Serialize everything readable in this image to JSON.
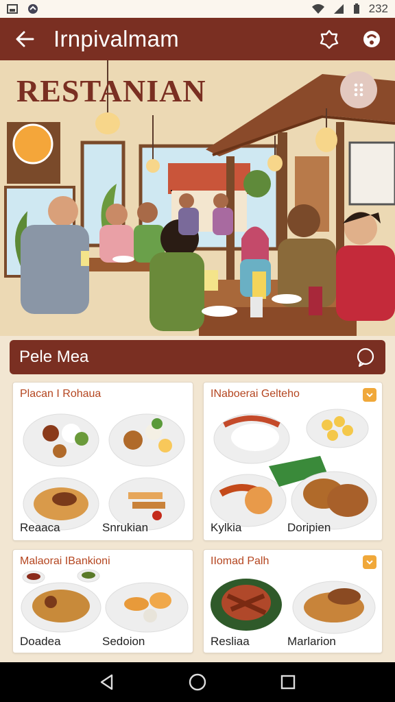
{
  "status_bar": {
    "time": "232"
  },
  "app_bar": {
    "title": "Irnpivalmam"
  },
  "hero": {
    "title": "RESTANIAN"
  },
  "section": {
    "label": "Pele Mea"
  },
  "cards": [
    {
      "title": "Placan I Rohaua",
      "dishes": [
        "Reaaca",
        "Snrukian"
      ]
    },
    {
      "title": "INaboerai Gelteho",
      "dishes": [
        "Kylkia",
        "Doripien"
      ]
    },
    {
      "title": "Malaorai IBankioni",
      "dishes": [
        "Doadea",
        "Sedoion"
      ]
    },
    {
      "title": "IIomad Palh",
      "dishes": [
        "Resliaa",
        "Marlarion"
      ]
    }
  ],
  "colors": {
    "brand": "#7a2f22",
    "accent": "#b4451f",
    "badge": "#f0a83a",
    "background": "#f2e6d2"
  }
}
